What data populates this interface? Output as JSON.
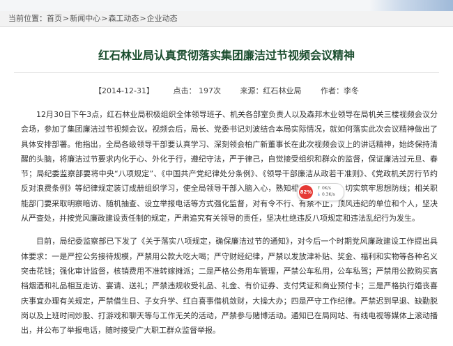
{
  "breadcrumb": {
    "label": "当前位置：",
    "items": [
      "首页",
      "新闻中心",
      "森工动态",
      "企业动态"
    ],
    "separator": ">"
  },
  "article": {
    "title": "红石林业局认真贯彻落实集团廉洁过节视频会议精神",
    "meta": {
      "date": "【2014-12-31】",
      "clicks": "点击： 197次",
      "source": "来源：红石林业局",
      "author": "作者：李冬"
    },
    "paragraphs": [
      "12月30日下午3点，红石林业局积极组织全体领导班子、机关各部室负责人以及森邦木业领导在局机关三楼视频会议分会场，参加了集团廉洁过节视频会议。视频会后，局长、党委书记刘波结合本局实际情况，就如何落实此次会议精神做出了具体安排部署。他指出，全局各级领导干部要认真学习、深刻领会柏广新董事长在此次视频会议上的讲话精神，始终保持清醒的头脑，将廉洁过节要求内化于心、外化于行，遵纪守法，严于律己，自觉接受组织和群众的监督，保证廉洁过元旦、春节；局纪委监察部要将中央“八项规定”、《中国共产党纪律处分条例》、《领导干部廉洁从政若干准则》、《党政机关厉行节约反对浪费条例》等纪律规定装订成册组织学习，使全局领导干部入脑入心，熟知相关规定要求，切实筑牢思想防线；相关职能部门要采取明察暗访、随机抽查、设立举报电话等方式强化监督，对有令不行、有禁不止，顶风违纪的单位和个人，坚决从严查处，并按党风廉政建设责任制的规定，严肃追究有关领导的责任，坚决杜绝违反八项规定和违法乱纪行为发生。",
      "目前，局纪委监察部已下发了《关于落实八项规定，确保廉洁过节的通知》，对今后一个时期党风廉政建设工作提出具体要求：一是严控公务接待规模，严禁用公款大吃大喝；严守财经纪律，严禁以发放津补贴、奖金、福利和实物等各种名义突击花钱；强化审计监督，核销费用不准转嫁摊派；二是严格公务用车管理，严禁公车私用，公车私驾；严禁用公款购买高档烟酒和礼品相互走访、宴请、送礼；严禁违规收受礼品、礼金、有价证券、支付凭证和商业预付卡；三是严格执行婚丧喜庆事宜办理有关规定，严禁借生日、子女升学、红白喜事借机敛财，大操大办；四是严守工作纪律。严禁迟到早退、缺勤脱岗以及上班时间炒股、打游戏和聊天等与工作无关的活动，严禁参与赌博活动。通知已在局网站、有线电视等媒体上滚动播出，并公布了举报电话，随时接受广大职工群众监督举报。"
    ]
  },
  "widget": {
    "percent": "82%",
    "up_speed": "0K/s",
    "down_speed": "0.3K/s"
  }
}
